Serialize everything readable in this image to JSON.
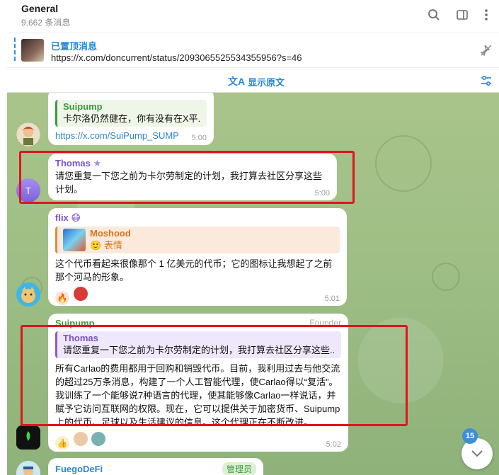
{
  "header": {
    "title": "General",
    "subtitle": "9,662 条消息"
  },
  "pinned": {
    "title": "已置顶消息",
    "text": "https://x.com/doncurrent/status/2093065525534355956?s=46"
  },
  "translate": {
    "label": "显示原文"
  },
  "messages": [
    {
      "reply_name": "Suipump",
      "reply_text": "卡尔洛仍然健在，你有没有在X平...",
      "link": "https://x.com/SuiPump_SUMP",
      "time": "5:00"
    },
    {
      "sender": "Thomas",
      "text": "请您重复一下您之前为卡尔劳制定的计划，我打算去社区分享这些计划。",
      "time": "5:00",
      "avatar_letter": "T"
    },
    {
      "sender": "flix",
      "reply_name": "Moshood",
      "reply_text": "表情",
      "text": "这个代币看起来很像那个 1 亿美元的代币；它的图标让我想起了之前那个河马的形象。",
      "time": "5:01"
    },
    {
      "sender": "Suipump",
      "role": "Founder",
      "reply_name": "Thomas",
      "reply_text": "请您重复一下您之前为卡尔劳制定的计划，我打算去社区分享这些...",
      "text": "所有Carlao的费用都用于回购和销毁代币。目前，我利用过去与他交流的超过25万条消息，构建了一个人工智能代理，使Carlao得以“复活”。我训练了一个能够说7种语言的代理，使其能够像Carlao一样说话，并赋予它访问互联网的权限。现在，它可以提供关于加密货币、Suipump上的代币、足球以及生活建议的信息。这个代理正在不断改进。",
      "time": "5:02"
    },
    {
      "sender": "FuegoDeFi",
      "role": "管理员"
    }
  ],
  "unread_count": "15",
  "colors": {
    "accent": "#2b86d1",
    "chat_bg": "#9fbf86",
    "highlight": "#e0141e"
  }
}
